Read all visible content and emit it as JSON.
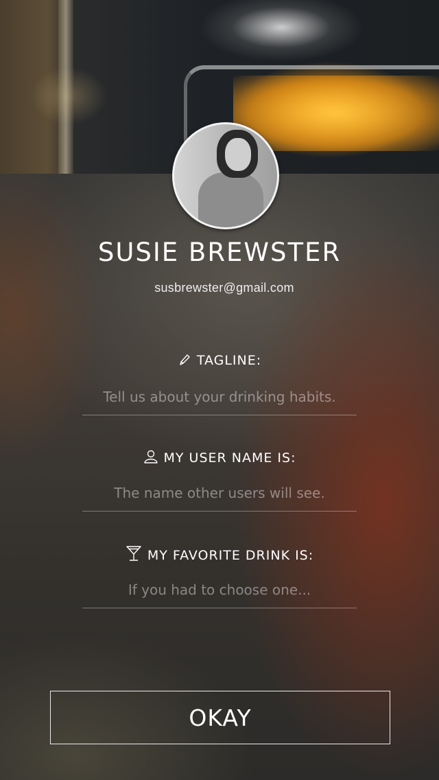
{
  "header": {
    "photo_alt": ""
  },
  "profile": {
    "name": "SUSIE BREWSTER",
    "email": "susbrewster@gmail.com"
  },
  "fields": [
    {
      "icon": "pencil-icon",
      "label": "TAGLINE:",
      "placeholder": "Tell us about your drinking habits.",
      "value": ""
    },
    {
      "icon": "user-icon",
      "label": "MY USER NAME IS:",
      "placeholder": "The name other users will see.",
      "value": ""
    },
    {
      "icon": "cocktail-icon",
      "label": "MY FAVORITE DRINK IS:",
      "placeholder": "If you had to choose one...",
      "value": ""
    }
  ],
  "actions": {
    "okay_label": "OKAY"
  }
}
